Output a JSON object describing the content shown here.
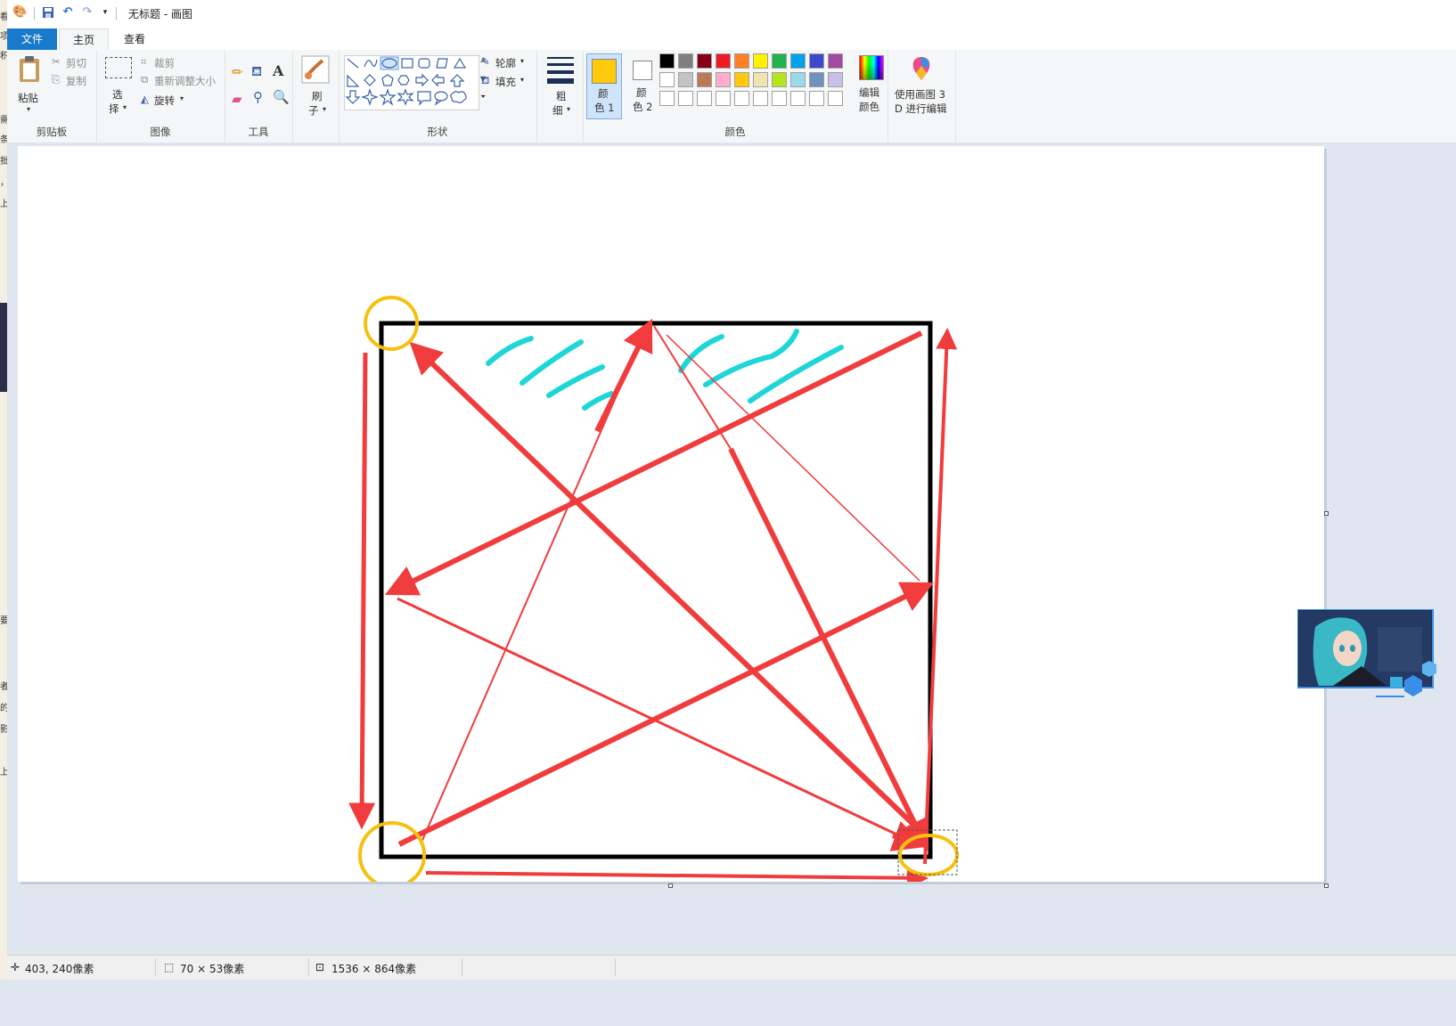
{
  "window": {
    "title": "无标题 - 画图"
  },
  "tabs": [
    {
      "label": "文件"
    },
    {
      "label": "主页"
    },
    {
      "label": "查看"
    }
  ],
  "ribbon": {
    "clipboard": {
      "group_label": "剪贴板",
      "paste": "粘贴",
      "cut": "剪切",
      "copy": "复制"
    },
    "image": {
      "group_label": "图像",
      "select_line1": "选",
      "select_line2": "择",
      "crop": "裁剪",
      "resize": "重新调整大小",
      "rotate": "旋转"
    },
    "tools": {
      "group_label": "工具"
    },
    "brushes": {
      "line1": "刷",
      "line2": "子"
    },
    "shapes": {
      "group_label": "形状",
      "outline": "轮廓",
      "fill": "填充"
    },
    "size": {
      "line1": "粗",
      "line2": "细"
    },
    "colors": {
      "group_label": "颜色",
      "color1_line1": "颜",
      "color1_line2": "色 1",
      "color2_line1": "颜",
      "color2_line2": "色 2",
      "edit_line1": "编辑",
      "edit_line2": "颜色",
      "color1_value": "#ffc90e",
      "color2_value": "#ffffff",
      "palette_row1": [
        "#000000",
        "#7f7f7f",
        "#880015",
        "#ed1c24",
        "#ff7f27",
        "#fff200",
        "#22b14c",
        "#00a2e8",
        "#3f48cc",
        "#a349a4"
      ],
      "palette_row2": [
        "#ffffff",
        "#c3c3c3",
        "#b97a57",
        "#ffaec9",
        "#ffc90e",
        "#efe4b0",
        "#b5e61d",
        "#99d9ea",
        "#7092be",
        "#c8bfe7"
      ],
      "palette_row3": [
        "#ffffff",
        "#ffffff",
        "#ffffff",
        "#ffffff",
        "#ffffff",
        "#ffffff",
        "#ffffff",
        "#ffffff",
        "#ffffff",
        "#ffffff"
      ]
    },
    "paint3d": {
      "line1": "使用画图 3",
      "line2": "D 进行编辑"
    }
  },
  "status": {
    "cursor_position": "403, 240像素",
    "selection_size": "70 × 53像素",
    "image_size": "1536 × 864像素"
  },
  "left_edge_chars": [
    "看",
    "项",
    "积",
    "需",
    "条",
    "批",
    "，",
    "上",
    "要",
    "者",
    "的",
    "影",
    "上"
  ],
  "drawing_colors": {
    "arrows": "#f03c3c",
    "circles": "#f5c10f",
    "hatching": "#1ed6d8",
    "square": "#000000"
  }
}
